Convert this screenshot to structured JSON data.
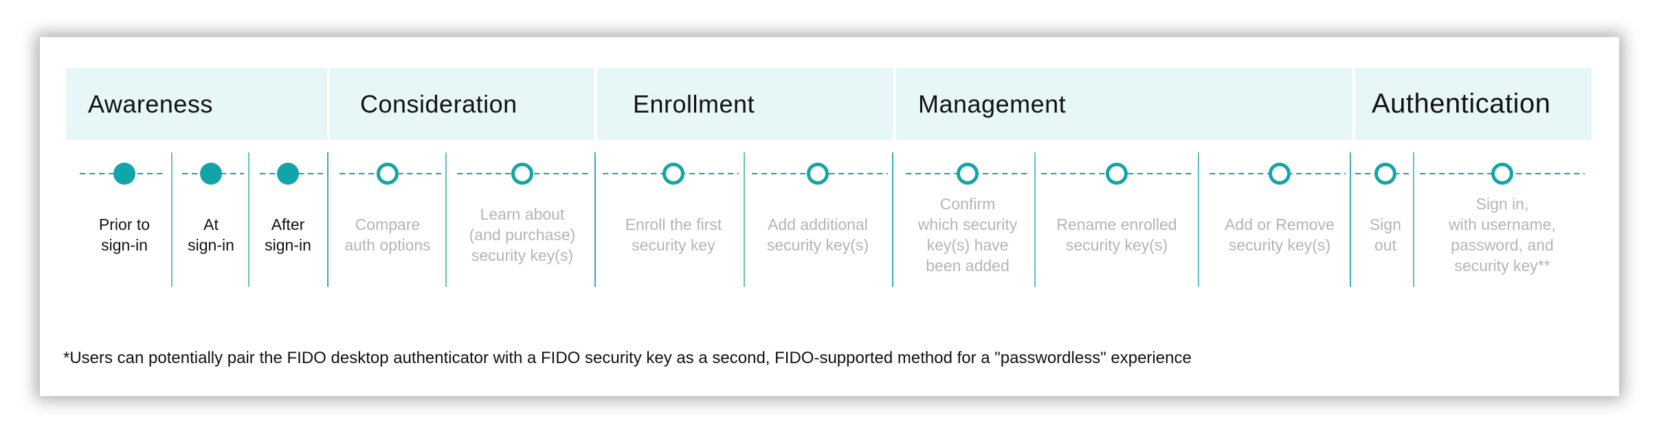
{
  "colors": {
    "accent": "#12a5a7",
    "header_bg": "#e7f6f6",
    "active_text": "#111111",
    "inactive_text": "#b4b4b4"
  },
  "stages": [
    {
      "label": "Awareness"
    },
    {
      "label": "Consideration"
    },
    {
      "label": "Enrollment"
    },
    {
      "label": "Management"
    },
    {
      "label": "Authentication"
    }
  ],
  "steps": [
    {
      "stage": "Awareness",
      "label": "Prior to\nsign-in",
      "marker": "filled-circle",
      "active": true
    },
    {
      "stage": "Awareness",
      "label": "At\nsign-in",
      "marker": "filled-circle",
      "active": true
    },
    {
      "stage": "Awareness",
      "label": "After\nsign-in",
      "marker": "filled-circle",
      "active": true
    },
    {
      "stage": "Consideration",
      "label": "Compare\nauth options",
      "marker": "hollow-circle",
      "active": false
    },
    {
      "stage": "Consideration",
      "label": "Learn about\n(and purchase)\nsecurity key(s)",
      "marker": "hollow-circle",
      "active": false
    },
    {
      "stage": "Enrollment",
      "label": "Enroll the first\nsecurity key",
      "marker": "hollow-circle",
      "active": false
    },
    {
      "stage": "Enrollment",
      "label": "Add additional\nsecurity key(s)",
      "marker": "hollow-circle",
      "active": false
    },
    {
      "stage": "Management",
      "label": "Confirm\nwhich security\nkey(s) have\nbeen added",
      "marker": "hollow-circle",
      "active": false
    },
    {
      "stage": "Management",
      "label": "Rename enrolled\nsecurity key(s)",
      "marker": "hollow-circle",
      "active": false
    },
    {
      "stage": "Management",
      "label": "Add or Remove\nsecurity key(s)",
      "marker": "hollow-circle",
      "active": false
    },
    {
      "stage": "Authentication",
      "label": "Sign\nout",
      "marker": "hollow-circle",
      "active": false
    },
    {
      "stage": "Authentication",
      "label": "Sign in,\nwith username,\npassword, and\nsecurity key**",
      "marker": "hollow-circle",
      "active": false
    }
  ],
  "footnote": "*Users can potentially pair the FIDO desktop authenticator with a FIDO security key as a second, FIDO-supported method for a \"passwordless\" experience"
}
